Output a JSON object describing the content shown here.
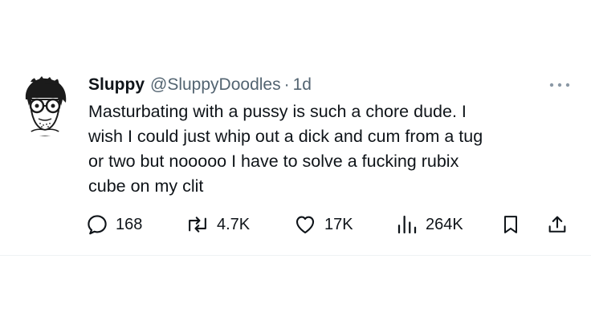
{
  "user": {
    "display_name": "Sluppy",
    "handle": "@SluppyDoodles",
    "separator": "·",
    "timestamp": "1d"
  },
  "tweet": {
    "text": "Masturbating with a pussy is such a chore dude. I\nwish I could just whip out a dick and cum from a tug\nor two but nooooo I have to solve a fucking rubix\ncube on my clit"
  },
  "actions": {
    "replies": "168",
    "reposts": "4.7K",
    "likes": "17K",
    "views": "264K"
  },
  "icons": {
    "more": "more-horizontal-icon",
    "reply": "reply-icon",
    "repost": "repost-icon",
    "like": "heart-icon",
    "views": "views-icon",
    "bookmark": "bookmark-icon",
    "share": "share-icon"
  },
  "colors": {
    "text": "#0f1419",
    "secondary": "#536471",
    "divider": "#eff3f4"
  }
}
